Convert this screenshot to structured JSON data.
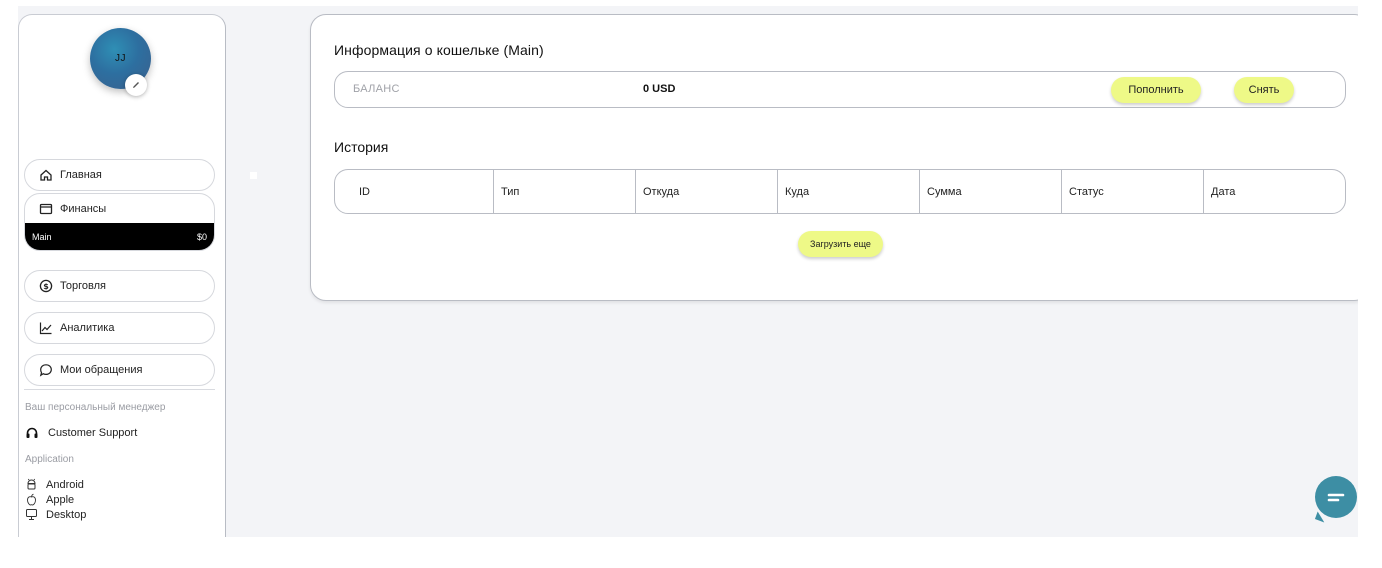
{
  "user": {
    "initials": "JJ"
  },
  "sidebar": {
    "nav": [
      {
        "label": "Главная",
        "icon": "home-icon"
      },
      {
        "label": "Финансы",
        "icon": "wallet-icon"
      },
      {
        "label": "Торговля",
        "icon": "dollar-icon"
      },
      {
        "label": "Аналитика",
        "icon": "chart-line-icon"
      },
      {
        "label": "Мои обращения",
        "icon": "chat-bubble-icon"
      }
    ],
    "wallet": {
      "name": "Main",
      "amount": "$0"
    },
    "manager_label": "Ваш персональный менеджер",
    "support_label": "Customer Support",
    "application_label": "Application",
    "platforms": [
      {
        "label": "Android",
        "icon": "android-icon"
      },
      {
        "label": "Apple",
        "icon": "apple-icon"
      },
      {
        "label": "Desktop",
        "icon": "desktop-icon"
      }
    ]
  },
  "wallet_card": {
    "title": "Информация о кошельке (Main)",
    "balance_label": "БАЛАНС",
    "balance_value": "0 USD",
    "deposit_label": "Пополнить",
    "withdraw_label": "Снять"
  },
  "history": {
    "title": "История",
    "columns": [
      "ID",
      "Тип",
      "Откуда",
      "Куда",
      "Сумма",
      "Статус",
      "Дата"
    ],
    "load_more_label": "Загрузить еще"
  },
  "colors": {
    "accent_button": "#eef987",
    "avatar": "#2d6fa0",
    "chat_fab": "#3d8ea4",
    "wallet_row": "#000000"
  }
}
